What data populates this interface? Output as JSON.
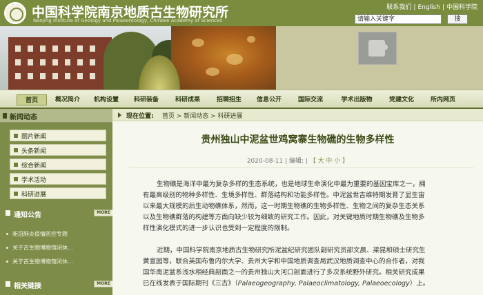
{
  "header": {
    "title": "中国科学院南京地质古生物研究所",
    "subtitle": "Nanjing Institute of Geology and Palaeontology, Chinese Academy of Sciences",
    "top_links": [
      "联系我们",
      "English",
      "中国科学院"
    ],
    "search_placeholder": "请输入关键字",
    "search_button": "搜"
  },
  "nav": {
    "items": [
      "首页",
      "概况简介",
      "机构设置",
      "科研装备",
      "科研成果",
      "招聘招生",
      "信息公开",
      "国际交流",
      "学术出版物",
      "党建文化",
      "所内网页"
    ],
    "active_index": 0
  },
  "sidebar": {
    "section_title": "新闻动态",
    "items": [
      "图片新闻",
      "头条新闻",
      "综合新闻",
      "学术活动",
      "科研进展"
    ],
    "notice_title": "通知公告",
    "more_label": "MORE",
    "notices": [
      "新冠肺炎疫情防控专题",
      "关于古生物博物馆闭休...",
      "关于古生物博物馆闭休..."
    ],
    "links_title": "相关链接"
  },
  "breadcrumb": {
    "label": "现在位置:",
    "path": "首页 > 新闻动态 > 科研进展"
  },
  "article": {
    "title": "贵州独山中泥盆世鸡窝寨生物礁的生物多样性",
    "date": "2020-08-11",
    "editor": "| 编辑: | ",
    "font_size": "【 大 中 小 】",
    "paragraph1": [
      "生物礁是海洋中最为复杂多样的生态系统，也是地球生命演化中最为重要的基因宝库之一，拥",
      "有最高级别的物种多样性、生境多样性、群落结构和功能多样性。中泥盆世吉维特期发育了显生宙",
      "以来最大规模的后生动物礁体系，然而，这一时期生物礁的生物多样性、生物之间的复杂生态关系",
      "以及生物礁群落的构建等方面向缺少较为细致的研究工作。因此，对关键地质时期生物礁及生物多",
      "样性演化模式的进一步认识也受到一定程度的限制。"
    ],
    "paragraph2": [
      "近期，中国科学院南京地质古生物研究所泥盆纪研究团队副研究员邵文晨、梁昆和硕士研究生",
      "黄宣园等，联合英国布鲁内尔大学、贵州大学和中国地质调查局武汉地质调查中心的合作者，对我",
      "国华南泥盆系浅水相经典剖面之一的贵州独山大河口剖面进行了多次系统野外研究。相关研究成果",
      "已在线发表于国际期刊《三古》（"
    ],
    "journal_en": "Palaeogeography, Palaeoclimatology, Palaeoecology",
    "paragraph2_end": "）上。"
  }
}
